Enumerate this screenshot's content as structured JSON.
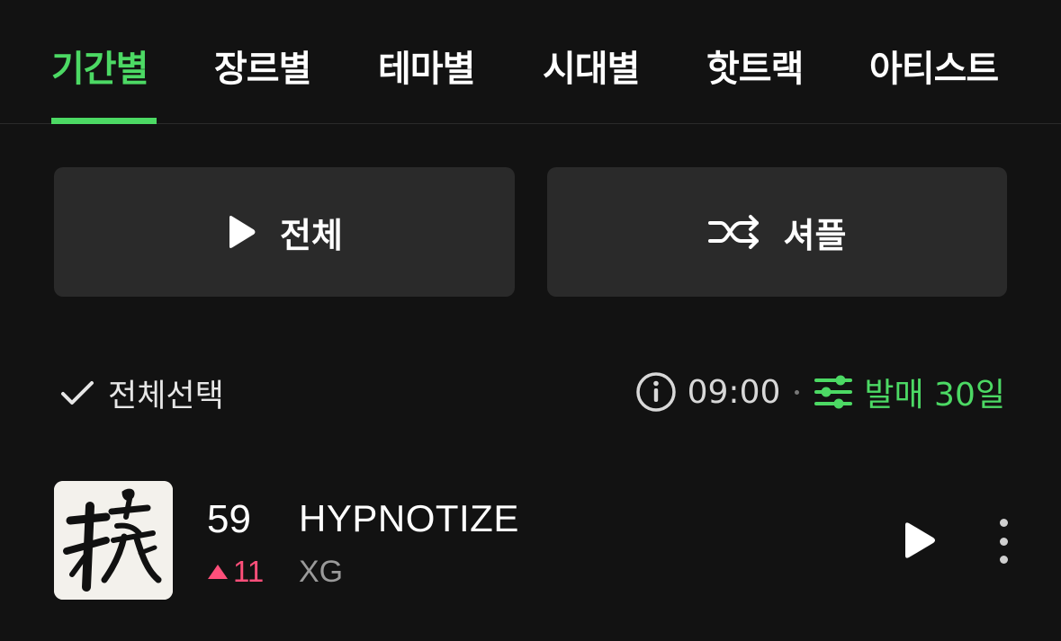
{
  "tabs": {
    "items": [
      {
        "label": "기간별"
      },
      {
        "label": "장르별"
      },
      {
        "label": "테마별"
      },
      {
        "label": "시대별"
      },
      {
        "label": "핫트랙"
      },
      {
        "label": "아티스트"
      }
    ],
    "active_index": 0
  },
  "actions": {
    "play_all_label": "전체",
    "shuffle_label": "셔플"
  },
  "toolbar": {
    "select_all_label": "전체선택",
    "time": "09:00",
    "filter_label": "발매 30일"
  },
  "track": {
    "rank": "59",
    "rank_change": "11",
    "rank_direction": "up",
    "title": "HYPNOTIZE",
    "artist": "XG"
  },
  "colors": {
    "accent": "#4cd964",
    "background": "#121212",
    "button_bg": "#2a2a2a",
    "rank_up": "#ff4f7a",
    "muted_text": "#9a9a9a"
  },
  "icons": {
    "play_all": "play-icon",
    "shuffle": "shuffle-icon",
    "select_all": "checkmark-icon",
    "info": "info-icon",
    "filter": "sliders-icon",
    "rank_change": "triangle-up-icon",
    "track_play": "play-icon",
    "more": "more-vertical-icon"
  }
}
